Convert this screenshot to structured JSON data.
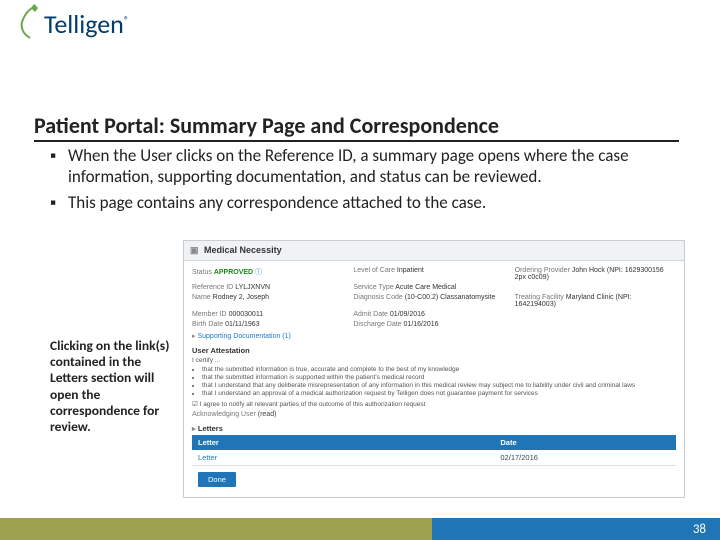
{
  "logo": {
    "brand": "Telligen",
    "reg": "®"
  },
  "title": "Patient Portal:  Summary Page and Correspondence",
  "bullets": [
    "When the User clicks on the Reference ID, a summary page opens where the case information, supporting documentation, and status can be reviewed.",
    "This page contains any correspondence attached to the case."
  ],
  "sideNote": "Clicking on the link(s) contained in the Letters section will open the correspondence for review.",
  "shot": {
    "panelTitle": "Medical Necessity",
    "status": {
      "label": "Status",
      "value": "APPROVED"
    },
    "levelOfCare": {
      "label": "Level of Care",
      "value": "Inpatient"
    },
    "orderingProvider": {
      "label": "Ordering Provider",
      "value": "John Hock (NPI: 1629300156 2px c0c09)"
    },
    "referenceId": {
      "label": "Reference ID",
      "value": "LYLJXNVN"
    },
    "serviceType": {
      "label": "Service Type",
      "value": "Acute Care Medical"
    },
    "name": {
      "label": "Name",
      "value": "Rodney 2, Joseph"
    },
    "diagnosis": {
      "label": "Diagnosis Code",
      "value": "(10-C00.2) Classanatomysite"
    },
    "treatingFacility": {
      "label": "Treating Facility",
      "value": "Maryland Clinic (NPI: 1642194003)"
    },
    "memberId": {
      "label": "Member ID",
      "value": "000030011"
    },
    "admitDate": {
      "label": "Admit Date",
      "value": "01/09/2016"
    },
    "birthDate": {
      "label": "Birth Date",
      "value": "01/11/1963"
    },
    "dischargeDate": {
      "label": "Discharge Date",
      "value": "01/16/2016"
    },
    "supportingDoc": "Supporting Documentation (1)",
    "userAttestationTitle": "User Attestation",
    "certify": "I certify ...",
    "attestations": [
      "that the submitted information is true, accurate and complete to the best of my knowledge",
      "that the submitted information is supported within the patient's medical record",
      "that I understand that any deliberate misrepresentation of any information in this medical review may subject me to liability under civil and criminal laws",
      "that I understand an approval of a medical authorization request by Telligen does not guarantee payment for services"
    ],
    "agree": "I agree to notify all relevant parties of the outcome of this authorization request",
    "ackUserLabel": "Acknowledging User",
    "ackUserValue": "(read)",
    "lettersTitle": "Letters",
    "lettersHeader": {
      "col1": "Letter",
      "col2": "Date"
    },
    "lettersRow": {
      "name": "Letter",
      "date": "02/17/2016"
    },
    "doneBtn": "Done"
  },
  "pageNumber": "38"
}
